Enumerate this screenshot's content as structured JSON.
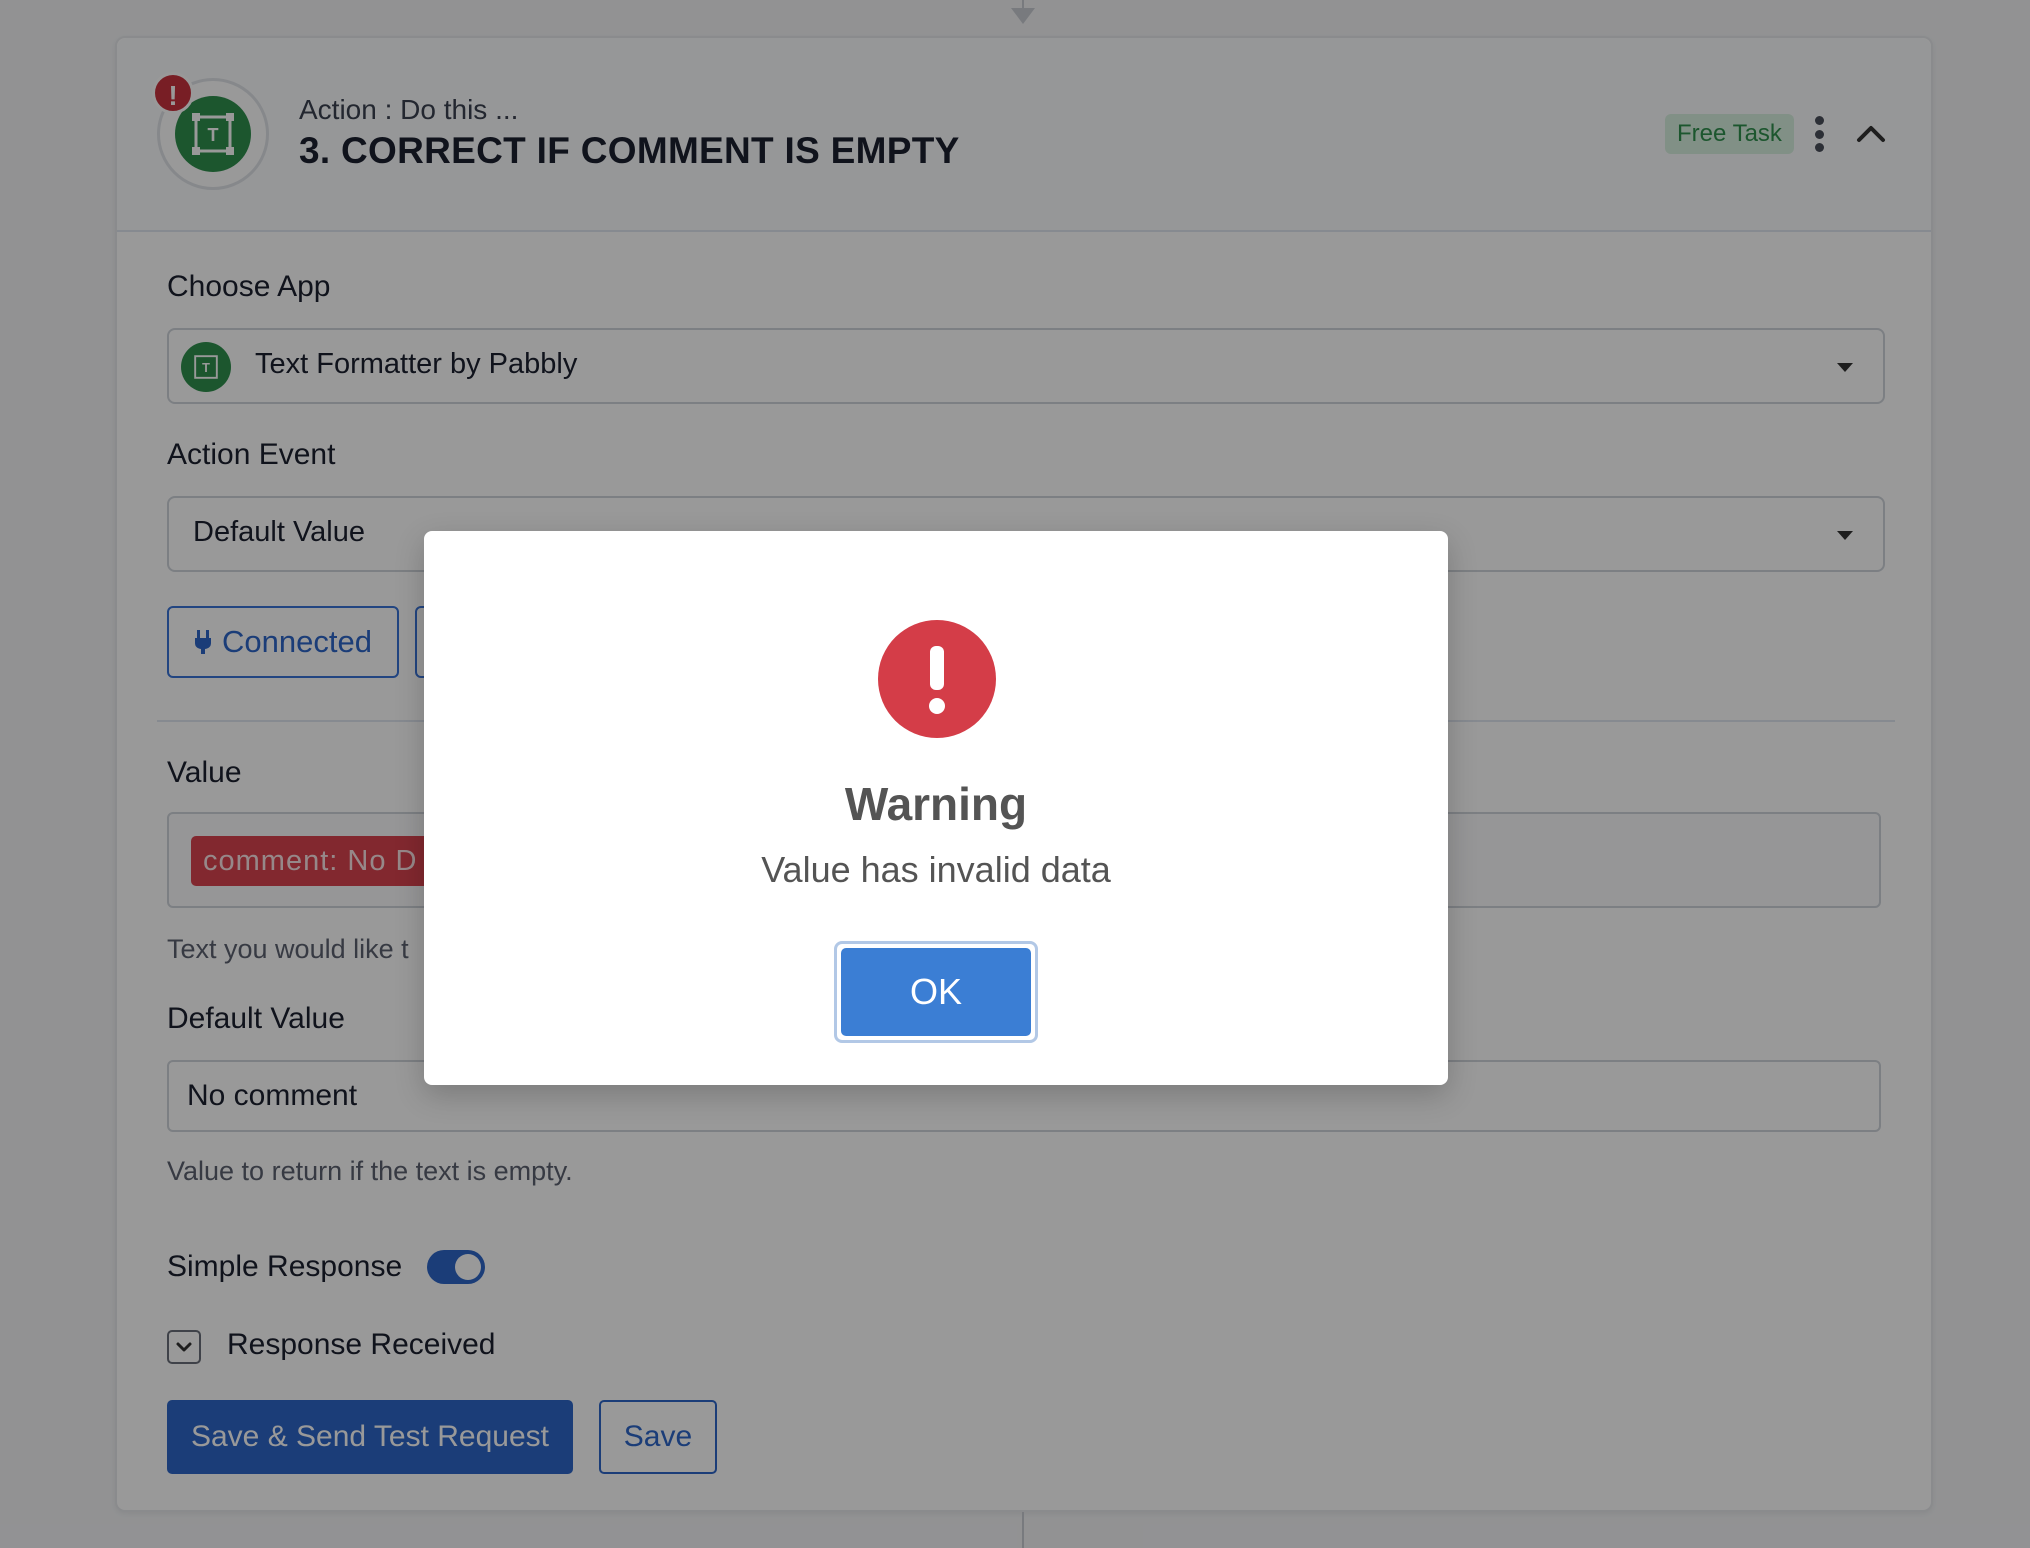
{
  "step": {
    "kicker": "Action : Do this ...",
    "title": "3. CORRECT IF COMMENT IS EMPTY",
    "badge": "Free Task",
    "error_badge": "!"
  },
  "form": {
    "choose_app_label": "Choose App",
    "choose_app_value": "Text Formatter by Pabbly",
    "action_event_label": "Action Event",
    "action_event_value": "Default Value",
    "connected_label": "Connected",
    "value_label": "Value",
    "value_chip": "comment: No D",
    "value_helper": "Text you would like t",
    "default_value_label": "Default Value",
    "default_value_value": "No comment",
    "default_value_helper": "Value to return if the text is empty.",
    "simple_response_label": "Simple Response",
    "simple_response_on": true,
    "response_received_label": "Response Received",
    "save_test_label": "Save & Send Test Request",
    "save_label": "Save"
  },
  "modal": {
    "title": "Warning",
    "message": "Value has invalid data",
    "ok_label": "OK"
  },
  "colors": {
    "primary": "#2d66c9",
    "error": "#d43d48",
    "app_green": "#2f8f4e",
    "badge_bg": "#d7f0df"
  }
}
